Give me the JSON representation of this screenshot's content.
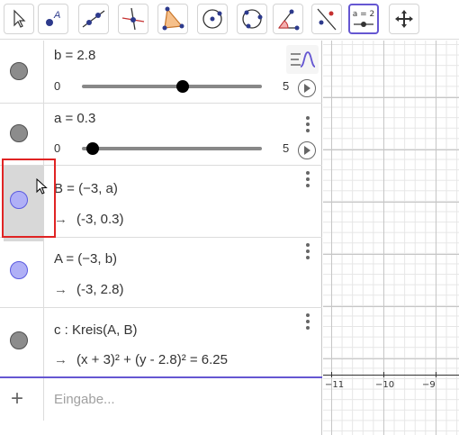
{
  "toolbar": {
    "tools": [
      {
        "icon": "move-pointer-icon",
        "selected": false
      },
      {
        "icon": "point-icon",
        "selected": false
      },
      {
        "icon": "line-icon",
        "selected": false
      },
      {
        "icon": "perpendicular-line-icon",
        "selected": false
      },
      {
        "icon": "polygon-icon",
        "selected": false
      },
      {
        "icon": "circle-center-point-icon",
        "selected": false
      },
      {
        "icon": "circle-three-points-icon",
        "selected": false
      },
      {
        "icon": "angle-icon",
        "selected": false
      },
      {
        "icon": "reflect-about-line-icon",
        "selected": false
      },
      {
        "icon": "slider-icon",
        "selected": true,
        "label": "a = 2"
      },
      {
        "icon": "move-graphics-view-icon",
        "selected": false
      }
    ]
  },
  "algebra": {
    "rows": [
      {
        "type": "slider",
        "definition": "b = 2.8",
        "min": "0",
        "max": "5",
        "value": 2.8,
        "visible": false
      },
      {
        "type": "slider",
        "definition": "a = 0.3",
        "min": "0",
        "max": "5",
        "value": 0.3,
        "visible": false
      },
      {
        "type": "point",
        "definition": "B = (−3, a)",
        "output": "(-3, 0.3)",
        "visible": true,
        "highlighted": true
      },
      {
        "type": "point",
        "definition": "A = (−3, b)",
        "output": "(-3, 2.8)",
        "visible": true
      },
      {
        "type": "conic",
        "definition": "c : Kreis(A, B)",
        "output": "(x + 3)² + (y - 2.8)² = 6.25",
        "visible": false
      }
    ],
    "input_placeholder": "Eingabe...",
    "arrow": "→"
  },
  "graphics": {
    "x_tick_labels": [
      "−11",
      "−10",
      "−9"
    ]
  },
  "colors": {
    "accent": "#6557d2",
    "highlight_border": "#e02424",
    "point_fill": "#b0b0f6"
  }
}
